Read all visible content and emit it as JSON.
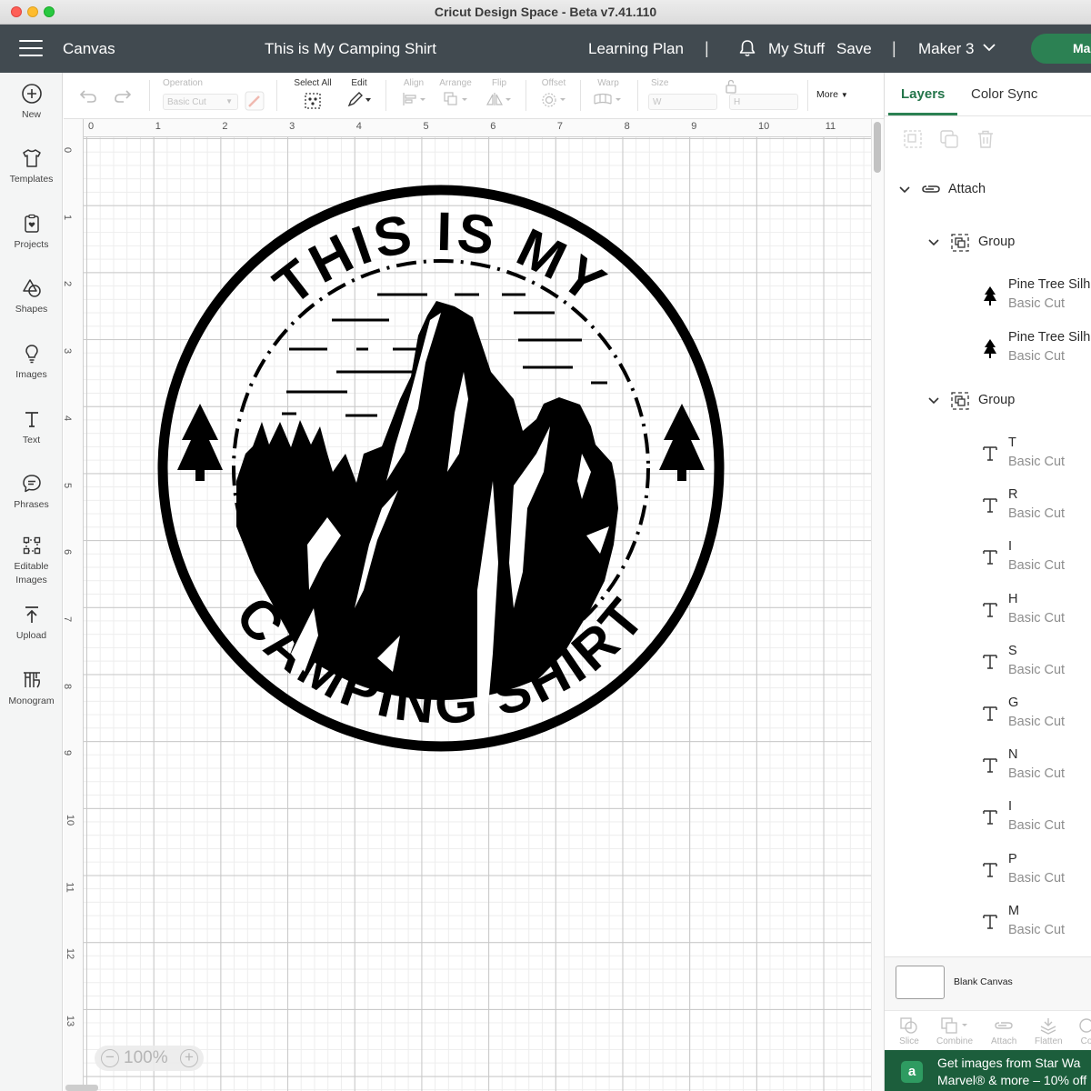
{
  "window": {
    "title": "Cricut Design Space - Beta v7.41.110"
  },
  "header": {
    "section": "Canvas",
    "project_title": "This is My Camping Shirt",
    "learning_plan": "Learning Plan",
    "separator": "|",
    "my_stuff": "My Stuff",
    "save": "Save",
    "machine": "Maker 3",
    "make_button": "Make"
  },
  "sidebar": {
    "items": [
      {
        "label": "New",
        "icon": "plus-circle-icon"
      },
      {
        "label": "Templates",
        "icon": "shirt-icon"
      },
      {
        "label": "Projects",
        "icon": "clipboard-heart-icon"
      },
      {
        "label": "Shapes",
        "icon": "shapes-icon"
      },
      {
        "label": "Images",
        "icon": "lightbulb-icon"
      },
      {
        "label": "Text",
        "icon": "text-t-icon"
      },
      {
        "label": "Phrases",
        "icon": "speech-bubble-icon"
      },
      {
        "label": "Editable Images",
        "icon": "editable-image-icon"
      },
      {
        "label": "Upload",
        "icon": "upload-icon"
      },
      {
        "label": "Monogram",
        "icon": "monogram-icon"
      }
    ]
  },
  "toolbar": {
    "operation_label": "Operation",
    "operation_value": "Basic Cut",
    "select_all": "Select All",
    "edit": "Edit",
    "align": "Align",
    "arrange": "Arrange",
    "flip": "Flip",
    "offset": "Offset",
    "warp": "Warp",
    "size": "Size",
    "w": "W",
    "h": "H",
    "more": "More"
  },
  "canvas": {
    "ruler_x": [
      "0",
      "1",
      "2",
      "3",
      "4",
      "5",
      "6",
      "7",
      "8",
      "9",
      "10",
      "11"
    ],
    "ruler_y": [
      "0",
      "1",
      "2",
      "3",
      "4",
      "5",
      "6",
      "7",
      "8",
      "9",
      "10",
      "11",
      "12",
      "13"
    ],
    "zoom": "100%",
    "design": {
      "top_text": "THIS IS MY",
      "bottom_text": "CAMPING SHIRT"
    }
  },
  "layers_panel": {
    "tabs": [
      "Layers",
      "Color Sync"
    ],
    "active_tab": "Layers",
    "attach_label": "Attach",
    "groups": [
      {
        "label": "Group",
        "children": [
          {
            "name": "Pine Tree Silh",
            "op": "Basic Cut"
          },
          {
            "name": "Pine Tree Silh",
            "op": "Basic Cut"
          }
        ]
      },
      {
        "label": "Group",
        "children": [
          {
            "name": "T",
            "op": "Basic Cut"
          },
          {
            "name": "R",
            "op": "Basic Cut"
          },
          {
            "name": "I",
            "op": "Basic Cut"
          },
          {
            "name": "H",
            "op": "Basic Cut"
          },
          {
            "name": "S",
            "op": "Basic Cut"
          },
          {
            "name": "G",
            "op": "Basic Cut"
          },
          {
            "name": "N",
            "op": "Basic Cut"
          },
          {
            "name": "I",
            "op": "Basic Cut"
          },
          {
            "name": "P",
            "op": "Basic Cut"
          },
          {
            "name": "M",
            "op": "Basic Cut"
          }
        ]
      }
    ],
    "blank_canvas": "Blank Canvas",
    "bottom_tools": [
      "Slice",
      "Combine",
      "Attach",
      "Flatten",
      "Co"
    ],
    "banner_icon": "a",
    "banner_line1": "Get images from Star Wa",
    "banner_line2": "Marvel® & more – 10% off"
  },
  "colors": {
    "header_bg": "#414a50",
    "accent_green": "#2c8153",
    "banner_bg": "#1c5e3c"
  }
}
